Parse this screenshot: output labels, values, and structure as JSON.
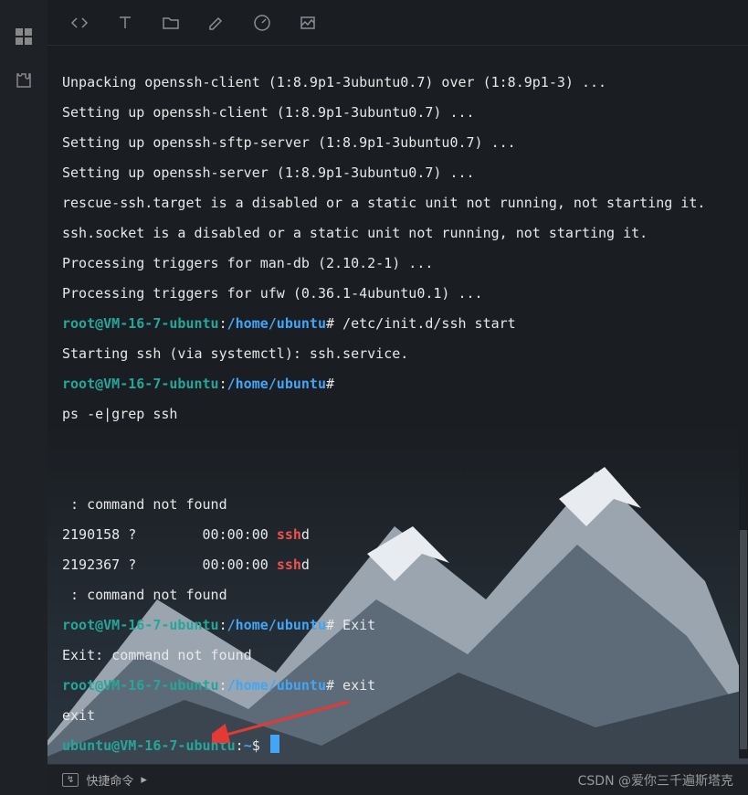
{
  "terminal": {
    "lines": [
      {
        "type": "plain",
        "text": "Unpacking openssh-client (1:8.9p1-3ubuntu0.7) over (1:8.9p1-3) ..."
      },
      {
        "type": "plain",
        "text": "Setting up openssh-client (1:8.9p1-3ubuntu0.7) ..."
      },
      {
        "type": "plain",
        "text": "Setting up openssh-sftp-server (1:8.9p1-3ubuntu0.7) ..."
      },
      {
        "type": "plain",
        "text": "Setting up openssh-server (1:8.9p1-3ubuntu0.7) ..."
      },
      {
        "type": "plain",
        "text": "rescue-ssh.target is a disabled or a static unit not running, not starting it."
      },
      {
        "type": "plain",
        "text": "ssh.socket is a disabled or a static unit not running, not starting it."
      },
      {
        "type": "plain",
        "text": "Processing triggers for man-db (2.10.2-1) ..."
      },
      {
        "type": "plain",
        "text": "Processing triggers for ufw (0.36.1-4ubuntu0.1) ..."
      },
      {
        "type": "prompt",
        "user": "root@VM-16-7-ubuntu",
        "path": "/home/ubuntu",
        "sym": "#",
        "cmd": " /etc/init.d/ssh start"
      },
      {
        "type": "plain",
        "text": "Starting ssh (via systemctl): ssh.service."
      },
      {
        "type": "prompt",
        "user": "root@VM-16-7-ubuntu",
        "path": "/home/ubuntu",
        "sym": "#",
        "cmd": " "
      },
      {
        "type": "plain",
        "text": "ps -e|grep ssh"
      },
      {
        "type": "blank"
      },
      {
        "type": "blank"
      },
      {
        "type": "plain",
        "text": " : command not found"
      },
      {
        "type": "ps",
        "pid": "2190158 ?",
        "time": "00:00:00",
        "proc": "ssh",
        "suffix": "d"
      },
      {
        "type": "ps",
        "pid": "2192367 ?",
        "time": "00:00:00",
        "proc": "ssh",
        "suffix": "d"
      },
      {
        "type": "plain",
        "text": " : command not found"
      },
      {
        "type": "prompt",
        "user": "root@VM-16-7-ubuntu",
        "path": "/home/ubuntu",
        "sym": "#",
        "cmd": " Exit"
      },
      {
        "type": "plain",
        "text": "Exit: command not found"
      },
      {
        "type": "prompt",
        "user": "root@VM-16-7-ubuntu",
        "path": "/home/ubuntu",
        "sym": "#",
        "cmd": " exit"
      },
      {
        "type": "plain",
        "text": "exit"
      },
      {
        "type": "ubuntu_prompt",
        "user": "ubuntu@VM-16-7-ubuntu",
        "path": "~",
        "sym": "$",
        "cursor": true
      }
    ]
  },
  "bottom": {
    "quick_label": "快捷命令",
    "watermark": "CSDN @爱你三千遍斯塔克"
  },
  "toolbar_icons": [
    "code-icon",
    "text-icon",
    "folder-icon",
    "edit-icon",
    "gauge-icon",
    "image-icon"
  ],
  "sidebar_icons": [
    "dashboard-icon",
    "extension-icon"
  ]
}
